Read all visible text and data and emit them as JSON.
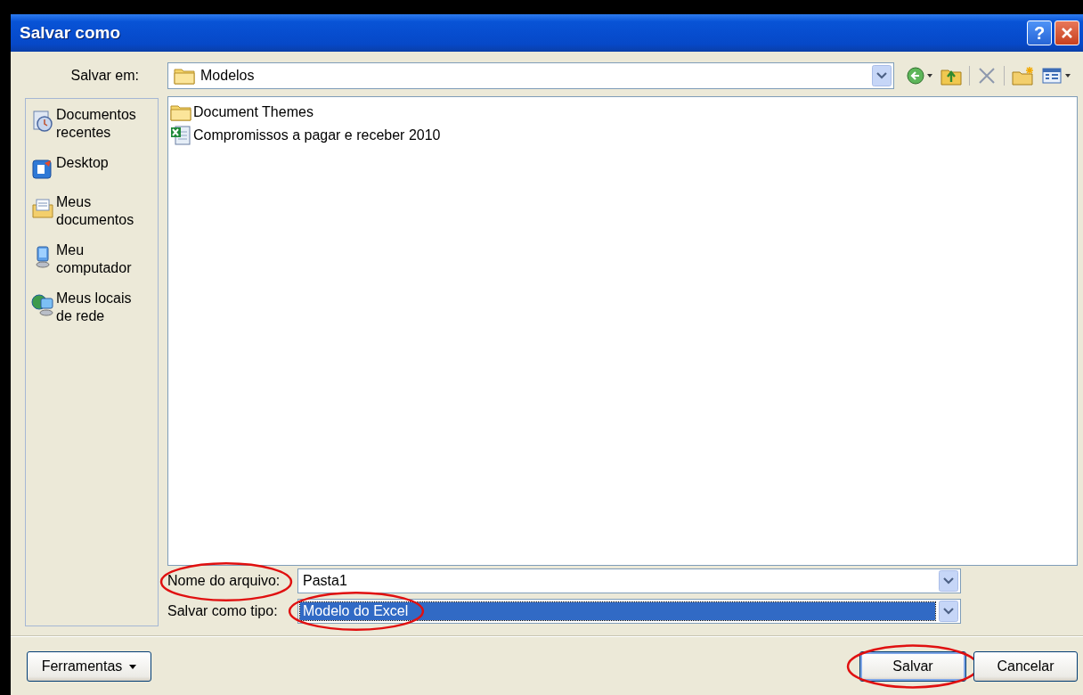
{
  "window": {
    "title": "Salvar como",
    "help_label": "?"
  },
  "save_in": {
    "label": "Salvar em:",
    "value": "Modelos"
  },
  "toolbar": [
    {
      "kind": "back"
    },
    {
      "kind": "up"
    },
    {
      "kind": "delete"
    },
    {
      "kind": "new-folder"
    },
    {
      "kind": "views"
    }
  ],
  "places": [
    {
      "kind": "recent",
      "label": "Documentos recentes"
    },
    {
      "kind": "desktop",
      "label": "Desktop"
    },
    {
      "kind": "documents",
      "label": "Meus documentos"
    },
    {
      "kind": "computer",
      "label": "Meu computador"
    },
    {
      "kind": "network",
      "label": "Meus locais de rede"
    }
  ],
  "files": [
    {
      "kind": "folder",
      "name": "Document Themes"
    },
    {
      "kind": "excel",
      "name": "Compromissos a pagar e receber 2010"
    }
  ],
  "file_name": {
    "label": "Nome do arquivo:",
    "value": "Pasta1",
    "circled": true
  },
  "file_type": {
    "label": "Salvar como tipo:",
    "value": "Modelo do Excel",
    "selected": true,
    "circled": true
  },
  "buttons": [
    {
      "kind": "menu",
      "label": "Ferramentas",
      "circled": false
    },
    {
      "kind": "default",
      "label": "Salvar",
      "circled": true
    },
    {
      "kind": "normal",
      "label": "Cancelar",
      "circled": false
    }
  ]
}
